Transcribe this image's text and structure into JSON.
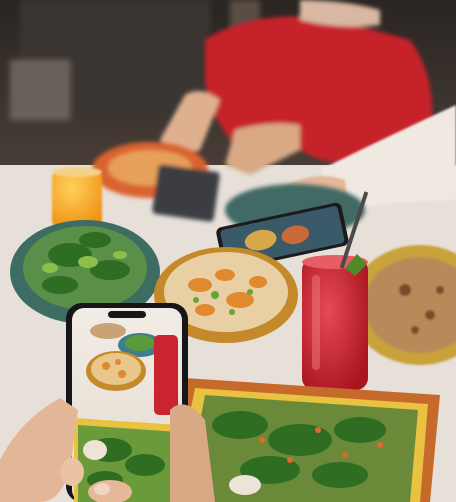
{
  "photo": {
    "subject": "phone-photographing-restaurant-food",
    "palette": {
      "background_dark": "#2b2320",
      "table": "#e7e1d9",
      "sweater_red": "#c6242b",
      "sleeve_white": "#ece6df",
      "plate_orange": "#d9632e",
      "plate_teal": "#3f6a63",
      "plate_yellow": "#d9b12f",
      "drink_red": "#c9242f",
      "juice_orange": "#f2a21e",
      "greens": "#4f8a2a",
      "phone_black": "#161616",
      "skin": "#e2b797"
    }
  }
}
